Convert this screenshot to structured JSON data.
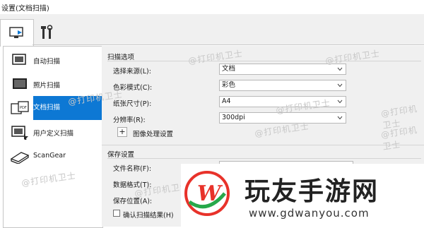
{
  "window": {
    "title": "设置(文档扫描)"
  },
  "tabs": [
    {
      "icon": "monitor-scan-icon"
    },
    {
      "icon": "tools-icon"
    }
  ],
  "sidebar": {
    "items": [
      {
        "label": "自动扫描",
        "icon": "auto-scan-icon",
        "active": false
      },
      {
        "label": "照片扫描",
        "icon": "photo-scan-icon",
        "active": false
      },
      {
        "label": "文档扫描",
        "icon": "document-scan-icon",
        "active": true
      },
      {
        "label": "用户定义扫描",
        "icon": "custom-scan-icon",
        "active": false
      },
      {
        "label": "ScanGear",
        "icon": "scangear-icon",
        "active": false
      }
    ]
  },
  "scan_options": {
    "title": "扫描选项",
    "fields": [
      {
        "label": "选择来源(L):",
        "value": "文档"
      },
      {
        "label": "色彩模式(C):",
        "value": "彩色"
      },
      {
        "label": "纸张尺寸(P):",
        "value": "A4"
      },
      {
        "label": "分辨率(R):",
        "value": "300dpi"
      }
    ],
    "image_processing": {
      "plus": "+",
      "label": "图像处理设置"
    }
  },
  "save_settings": {
    "title": "保存设置",
    "fields": [
      {
        "label": "文件名称(F):"
      },
      {
        "label": "数据格式(T):"
      },
      {
        "label": "保存位置(A):"
      }
    ],
    "confirm_checkbox": {
      "label": "确认扫描结果(H)",
      "checked": false
    }
  },
  "watermarks": [
    "@打印机卫士",
    "@打印机卫士",
    "@打印机卫士",
    "@打印机卫士",
    "@打印机卫士",
    "@打印机卫士",
    "@打印机卫士",
    "@打印机卫士",
    "@打印机卫士"
  ],
  "overlay": {
    "title": "玩友手游网",
    "url": "www.gdwanyou.com",
    "logo_letter": "W",
    "colors": {
      "red": "#e8322a",
      "green": "#27a84a"
    }
  },
  "colors": {
    "accent": "#0d78d4",
    "panel": "#f0f0f0"
  }
}
